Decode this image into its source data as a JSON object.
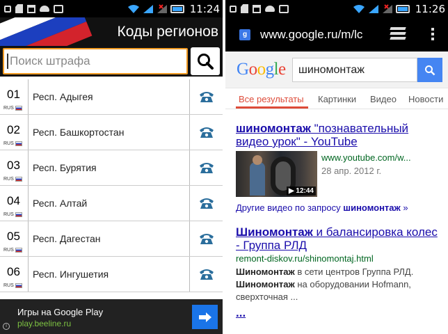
{
  "left": {
    "status": {
      "time": "11:24"
    },
    "app": {
      "title": "Коды регионов"
    },
    "search": {
      "placeholder": "Поиск штрафа"
    },
    "flag_colors": [
      "#ffffff",
      "#1c3fbf",
      "#d3232c"
    ],
    "regions": [
      {
        "code": "01",
        "name": "Респ. Адыгея",
        "country": "RUS"
      },
      {
        "code": "02",
        "name": "Респ. Башкортостан",
        "country": "RUS"
      },
      {
        "code": "03",
        "name": "Респ. Бурятия",
        "country": "RUS"
      },
      {
        "code": "04",
        "name": "Респ. Алтай",
        "country": "RUS"
      },
      {
        "code": "05",
        "name": "Респ. Дагестан",
        "country": "RUS"
      },
      {
        "code": "06",
        "name": "Респ. Ингушетия",
        "country": "RUS"
      }
    ],
    "ad": {
      "title": "Игры на Google Play",
      "url": "play.beeline.ru",
      "info": "i"
    }
  },
  "right": {
    "status": {
      "time": "11:26"
    },
    "browser": {
      "url": "www.google.ru/m/lc",
      "favicon_letter": "g"
    },
    "google": {
      "logo_letters": [
        {
          "ch": "G",
          "color": "#4285f4"
        },
        {
          "ch": "o",
          "color": "#ea4335"
        },
        {
          "ch": "o",
          "color": "#fbbc05"
        },
        {
          "ch": "g",
          "color": "#4285f4"
        },
        {
          "ch": "l",
          "color": "#34a853"
        },
        {
          "ch": "e",
          "color": "#ea4335"
        }
      ],
      "query": "шиномонтаж",
      "tabs": [
        "Все результаты",
        "Картинки",
        "Видео",
        "Новости"
      ]
    },
    "result1": {
      "title_bold": "шиномонтаж",
      "title_rest": " \"познавательный видео урок\" - YouTube",
      "url": "www.youtube.com/w...",
      "date": "28 апр. 2012 г.",
      "duration": "▶ 12:44",
      "more_prefix": "Другие видео по запросу ",
      "more_bold": "шиномонтаж",
      "more_suffix": " »"
    },
    "result2": {
      "title_bold": "Шиномонтаж",
      "title_rest": " и балансировка колес - Группа РЛД",
      "url": "remont-diskov.ru/shinomontaj.html",
      "s1_bold": "Шиномонтаж",
      "s1_rest": " в сети центров Группа РЛД.",
      "s2_bold": "Шиномонтаж",
      "s2_rest": " на оборудовании Hofmann, сверхточная ...",
      "more": "..."
    }
  }
}
